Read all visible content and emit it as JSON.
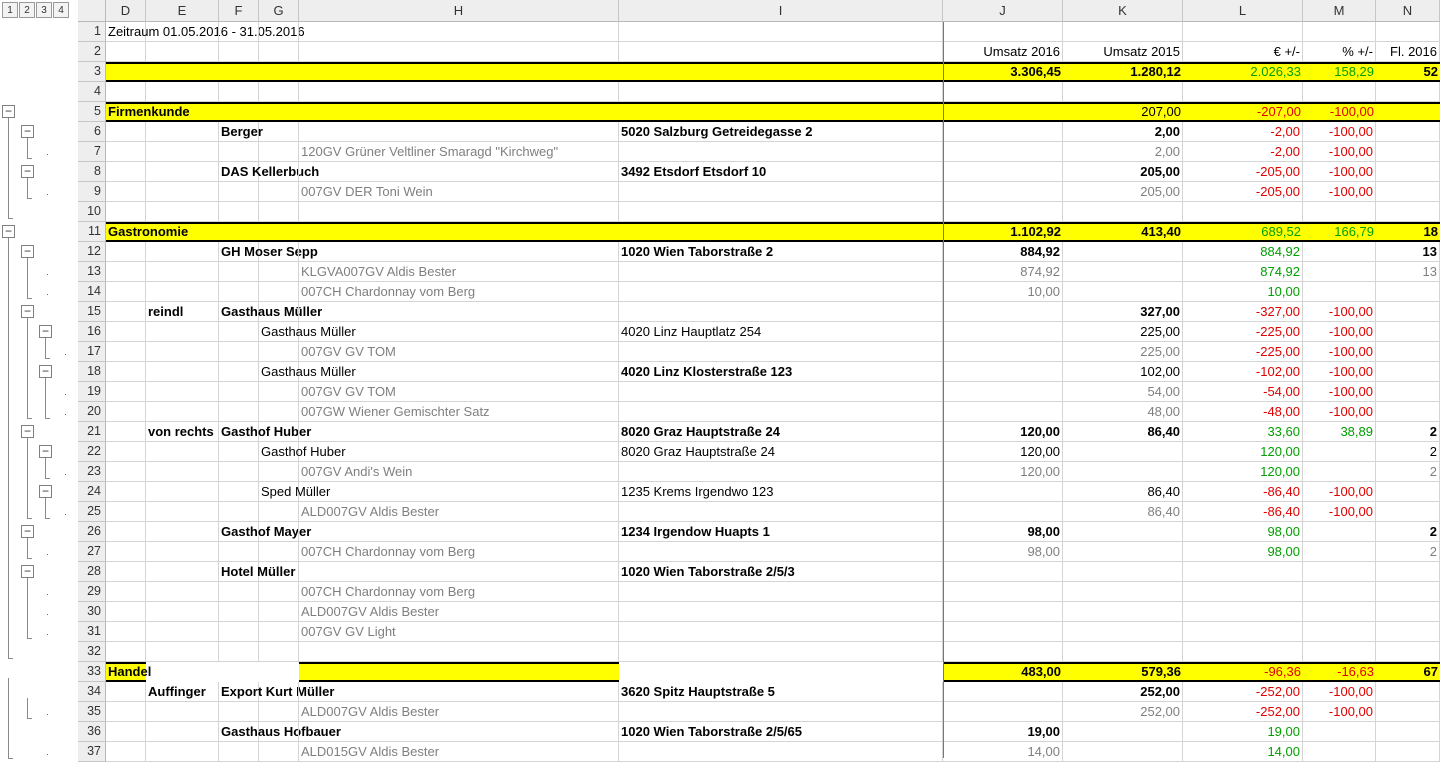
{
  "outline_levels": [
    "1",
    "2",
    "3",
    "4"
  ],
  "columns": [
    {
      "key": "D",
      "label": "D",
      "w": 40
    },
    {
      "key": "E",
      "label": "E",
      "w": 73
    },
    {
      "key": "F",
      "label": "F",
      "w": 40
    },
    {
      "key": "G",
      "label": "G",
      "w": 40
    },
    {
      "key": "H",
      "label": "H",
      "w": 320
    },
    {
      "key": "I",
      "label": "I",
      "w": 324
    },
    {
      "key": "J",
      "label": "J",
      "w": 120
    },
    {
      "key": "K",
      "label": "K",
      "w": 120
    },
    {
      "key": "L",
      "label": "L",
      "w": 120
    },
    {
      "key": "M",
      "label": "M",
      "w": 73
    },
    {
      "key": "N",
      "label": "N",
      "w": 64
    }
  ],
  "rows": [
    {
      "n": "1",
      "cells": {
        "D": {
          "t": "Zeitraum 01.05.2016 - 31.05.2016"
        }
      }
    },
    {
      "n": "2",
      "cells": {
        "J": {
          "t": "Umsatz 2016"
        },
        "K": {
          "t": "Umsatz 2015"
        },
        "L": {
          "t": "€ +/-"
        },
        "M": {
          "t": "% +/-"
        },
        "N": {
          "t": "Fl. 2016"
        }
      }
    },
    {
      "n": "3",
      "style": "total",
      "cells": {
        "J": {
          "t": "3.306,45",
          "b": 1
        },
        "K": {
          "t": "1.280,12",
          "b": 1
        },
        "L": {
          "t": "2.026,33",
          "c": "green"
        },
        "M": {
          "t": "158,29",
          "c": "green"
        },
        "N": {
          "t": "52",
          "b": 1
        }
      }
    },
    {
      "n": "4",
      "cells": {}
    },
    {
      "n": "5",
      "style": "group",
      "cells": {
        "D": {
          "t": "Firmenkunde"
        },
        "K": {
          "t": "207,00"
        },
        "L": {
          "t": "-207,00",
          "c": "red"
        },
        "M": {
          "t": "-100,00",
          "c": "red"
        }
      }
    },
    {
      "n": "6",
      "cells": {
        "F": {
          "t": "Berger",
          "b": 1
        },
        "I": {
          "t": "5020 Salzburg Getreidegasse 2",
          "b": 1
        },
        "K": {
          "t": "2,00",
          "b": 1
        },
        "L": {
          "t": "-2,00",
          "c": "red"
        },
        "M": {
          "t": "-100,00",
          "c": "red"
        }
      }
    },
    {
      "n": "7",
      "cells": {
        "H": {
          "t": "120GV Grüner Veltliner Smaragd \"Kirchweg\"",
          "c": "grey"
        },
        "K": {
          "t": "2,00",
          "c": "grey"
        },
        "L": {
          "t": "-2,00",
          "c": "red"
        },
        "M": {
          "t": "-100,00",
          "c": "red"
        }
      }
    },
    {
      "n": "8",
      "cells": {
        "F": {
          "t": "DAS Kellerbuch",
          "b": 1
        },
        "I": {
          "t": "3492 Etsdorf Etsdorf 10",
          "b": 1
        },
        "K": {
          "t": "205,00",
          "b": 1
        },
        "L": {
          "t": "-205,00",
          "c": "red"
        },
        "M": {
          "t": "-100,00",
          "c": "red"
        }
      }
    },
    {
      "n": "9",
      "cells": {
        "H": {
          "t": "007GV DER Toni Wein",
          "c": "grey"
        },
        "K": {
          "t": "205,00",
          "c": "grey"
        },
        "L": {
          "t": "-205,00",
          "c": "red"
        },
        "M": {
          "t": "-100,00",
          "c": "red"
        }
      }
    },
    {
      "n": "10",
      "cells": {}
    },
    {
      "n": "11",
      "style": "group",
      "cells": {
        "D": {
          "t": "Gastronomie"
        },
        "J": {
          "t": "1.102,92",
          "b": 1
        },
        "K": {
          "t": "413,40",
          "b": 1
        },
        "L": {
          "t": "689,52",
          "c": "green"
        },
        "M": {
          "t": "166,79",
          "c": "green"
        },
        "N": {
          "t": "18",
          "b": 1
        }
      }
    },
    {
      "n": "12",
      "cells": {
        "F": {
          "t": "GH Moser Sepp",
          "b": 1
        },
        "I": {
          "t": "1020 Wien Taborstraße 2",
          "b": 1
        },
        "J": {
          "t": "884,92",
          "b": 1
        },
        "L": {
          "t": "884,92",
          "c": "green"
        },
        "N": {
          "t": "13",
          "b": 1
        }
      }
    },
    {
      "n": "13",
      "cells": {
        "H": {
          "t": "KLGVA007GV Aldis Bester",
          "c": "grey"
        },
        "J": {
          "t": "874,92",
          "c": "grey"
        },
        "L": {
          "t": "874,92",
          "c": "green"
        },
        "N": {
          "t": "13",
          "c": "grey"
        }
      }
    },
    {
      "n": "14",
      "cells": {
        "H": {
          "t": "007CH Chardonnay vom Berg",
          "c": "grey"
        },
        "J": {
          "t": "10,00",
          "c": "grey"
        },
        "L": {
          "t": "10,00",
          "c": "green"
        }
      }
    },
    {
      "n": "15",
      "cells": {
        "E": {
          "t": "reindl",
          "b": 1
        },
        "F": {
          "t": "Gasthaus Müller",
          "b": 1
        },
        "K": {
          "t": "327,00",
          "b": 1
        },
        "L": {
          "t": "-327,00",
          "c": "red"
        },
        "M": {
          "t": "-100,00",
          "c": "red"
        }
      }
    },
    {
      "n": "16",
      "cells": {
        "G": {
          "t": "Gasthaus Müller"
        },
        "I": {
          "t": "4020 Linz Hauptlatz 254"
        },
        "K": {
          "t": "225,00"
        },
        "L": {
          "t": "-225,00",
          "c": "red"
        },
        "M": {
          "t": "-100,00",
          "c": "red"
        }
      }
    },
    {
      "n": "17",
      "cells": {
        "H": {
          "t": "007GV GV TOM",
          "c": "grey"
        },
        "K": {
          "t": "225,00",
          "c": "grey"
        },
        "L": {
          "t": "-225,00",
          "c": "red"
        },
        "M": {
          "t": "-100,00",
          "c": "red"
        }
      }
    },
    {
      "n": "18",
      "cells": {
        "G": {
          "t": "Gasthaus Müller"
        },
        "I": {
          "t": "4020 Linz Klosterstraße 123",
          "b": 1
        },
        "K": {
          "t": "102,00"
        },
        "L": {
          "t": "-102,00",
          "c": "red"
        },
        "M": {
          "t": "-100,00",
          "c": "red"
        }
      }
    },
    {
      "n": "19",
      "cells": {
        "H": {
          "t": "007GV GV TOM",
          "c": "grey"
        },
        "K": {
          "t": "54,00",
          "c": "grey"
        },
        "L": {
          "t": "-54,00",
          "c": "red"
        },
        "M": {
          "t": "-100,00",
          "c": "red"
        }
      }
    },
    {
      "n": "20",
      "cells": {
        "H": {
          "t": "007GW Wiener Gemischter Satz",
          "c": "grey"
        },
        "K": {
          "t": "48,00",
          "c": "grey"
        },
        "L": {
          "t": "-48,00",
          "c": "red"
        },
        "M": {
          "t": "-100,00",
          "c": "red"
        }
      }
    },
    {
      "n": "21",
      "cells": {
        "E": {
          "t": "von rechts",
          "b": 1
        },
        "F": {
          "t": "Gasthof Huber",
          "b": 1
        },
        "I": {
          "t": "8020 Graz Hauptstraße 24",
          "b": 1
        },
        "J": {
          "t": "120,00",
          "b": 1
        },
        "K": {
          "t": "86,40",
          "b": 1
        },
        "L": {
          "t": "33,60",
          "c": "green"
        },
        "M": {
          "t": "38,89",
          "c": "green"
        },
        "N": {
          "t": "2",
          "b": 1
        }
      }
    },
    {
      "n": "22",
      "cells": {
        "G": {
          "t": "Gasthof Huber"
        },
        "I": {
          "t": "8020 Graz Hauptstraße 24"
        },
        "J": {
          "t": "120,00"
        },
        "L": {
          "t": "120,00",
          "c": "green"
        },
        "N": {
          "t": "2"
        }
      }
    },
    {
      "n": "23",
      "cells": {
        "H": {
          "t": "007GV Andi's Wein",
          "c": "grey"
        },
        "J": {
          "t": "120,00",
          "c": "grey"
        },
        "L": {
          "t": "120,00",
          "c": "green"
        },
        "N": {
          "t": "2",
          "c": "grey"
        }
      }
    },
    {
      "n": "24",
      "cells": {
        "G": {
          "t": "Sped Müller"
        },
        "I": {
          "t": "1235 Krems Irgendwo 123"
        },
        "K": {
          "t": "86,40"
        },
        "L": {
          "t": "-86,40",
          "c": "red"
        },
        "M": {
          "t": "-100,00",
          "c": "red"
        }
      }
    },
    {
      "n": "25",
      "cells": {
        "H": {
          "t": "ALD007GV Aldis Bester",
          "c": "grey"
        },
        "K": {
          "t": "86,40",
          "c": "grey"
        },
        "L": {
          "t": "-86,40",
          "c": "red"
        },
        "M": {
          "t": "-100,00",
          "c": "red"
        }
      }
    },
    {
      "n": "26",
      "cells": {
        "F": {
          "t": "Gasthof Mayer",
          "b": 1
        },
        "I": {
          "t": "1234 Irgendow Huapts 1",
          "b": 1
        },
        "J": {
          "t": "98,00",
          "b": 1
        },
        "L": {
          "t": "98,00",
          "c": "green"
        },
        "N": {
          "t": "2",
          "b": 1
        }
      }
    },
    {
      "n": "27",
      "cells": {
        "H": {
          "t": "007CH Chardonnay vom Berg",
          "c": "grey"
        },
        "J": {
          "t": "98,00",
          "c": "grey"
        },
        "L": {
          "t": "98,00",
          "c": "green"
        },
        "N": {
          "t": "2",
          "c": "grey"
        }
      }
    },
    {
      "n": "28",
      "cells": {
        "F": {
          "t": "Hotel Müller",
          "b": 1
        },
        "I": {
          "t": "1020 Wien Taborstraße 2/5/3",
          "b": 1
        },
        "N": {
          "t": "",
          "b": 1
        }
      }
    },
    {
      "n": "29",
      "cells": {
        "H": {
          "t": "007CH Chardonnay vom Berg",
          "c": "grey"
        }
      }
    },
    {
      "n": "30",
      "cells": {
        "H": {
          "t": "ALD007GV Aldis Bester",
          "c": "grey"
        }
      }
    },
    {
      "n": "31",
      "cells": {
        "H": {
          "t": "007GV GV Light",
          "c": "grey"
        }
      }
    },
    {
      "n": "32",
      "cells": {}
    },
    {
      "n": "33",
      "style": "handel",
      "cells": {
        "D": {
          "t": "Handel"
        },
        "J": {
          "t": "483,00",
          "b": 1
        },
        "K": {
          "t": "579,36",
          "b": 1
        },
        "L": {
          "t": "-96,36",
          "c": "red"
        },
        "M": {
          "t": "-16,63",
          "c": "red"
        },
        "N": {
          "t": "67",
          "b": 1
        }
      }
    },
    {
      "n": "34",
      "cells": {
        "E": {
          "t": "Auffinger",
          "b": 1
        },
        "F": {
          "t": "Export Kurt Müller",
          "b": 1
        },
        "I": {
          "t": "3620 Spitz Hauptstraße 5",
          "b": 1
        },
        "K": {
          "t": "252,00",
          "b": 1
        },
        "L": {
          "t": "-252,00",
          "c": "red"
        },
        "M": {
          "t": "-100,00",
          "c": "red"
        }
      }
    },
    {
      "n": "35",
      "cells": {
        "H": {
          "t": "ALD007GV Aldis Bester",
          "c": "grey"
        },
        "K": {
          "t": "252,00",
          "c": "grey"
        },
        "L": {
          "t": "-252,00",
          "c": "red"
        },
        "M": {
          "t": "-100,00",
          "c": "red"
        }
      }
    },
    {
      "n": "36",
      "cells": {
        "F": {
          "t": "Gasthaus Hofbauer",
          "b": 1
        },
        "I": {
          "t": "1020 Wien Taborstraße 2/5/65",
          "b": 1
        },
        "J": {
          "t": "19,00",
          "b": 1
        },
        "L": {
          "t": "19,00",
          "c": "green"
        },
        "N": {
          "t": "",
          "b": 1
        }
      }
    },
    {
      "n": "37",
      "cells": {
        "H": {
          "t": "ALD015GV Aldis Bester",
          "c": "grey"
        },
        "J": {
          "t": "14,00",
          "c": "grey"
        },
        "L": {
          "t": "14,00",
          "c": "green"
        }
      }
    }
  ]
}
